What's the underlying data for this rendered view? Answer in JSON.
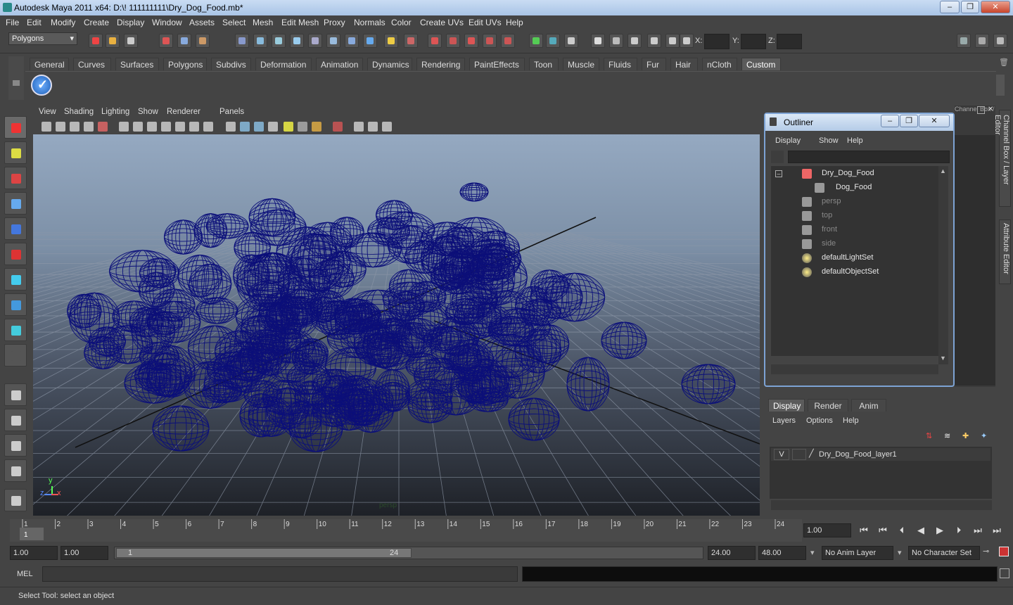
{
  "window": {
    "title": "Autodesk Maya 2011 x64: D:\\! 111111111\\Dry_Dog_Food.mb*",
    "min": "–",
    "max": "❐",
    "close": "✕"
  },
  "menus": [
    "File",
    "Edit",
    "Modify",
    "Create",
    "Display",
    "Window",
    "Assets",
    "Select",
    "Mesh",
    "Edit Mesh",
    "Proxy",
    "Normals",
    "Color",
    "Create UVs",
    "Edit UVs",
    "Help"
  ],
  "status": {
    "mode": "Polygons",
    "x_label": "X:",
    "y_label": "Y:",
    "z_label": "Z:"
  },
  "shelf_tabs": [
    "General",
    "Curves",
    "Surfaces",
    "Polygons",
    "Subdivs",
    "Deformation",
    "Animation",
    "Dynamics",
    "Rendering",
    "PaintEffects",
    "Toon",
    "Muscle",
    "Fluids",
    "Fur",
    "Hair",
    "nCloth",
    "Custom"
  ],
  "shelf_active": "Custom",
  "viewport": {
    "menus": [
      "View",
      "Shading",
      "Lighting",
      "Show",
      "Renderer",
      "Panels"
    ],
    "camera_label": "persp",
    "axis": {
      "x": "x",
      "y": "y",
      "z": "z"
    }
  },
  "outliner": {
    "title": "Outliner",
    "menus": [
      "Display",
      "Show",
      "Help"
    ],
    "items": [
      {
        "label": "Dry_Dog_Food",
        "dim": false,
        "icon": "transform-icon",
        "indent": 0
      },
      {
        "label": "Dog_Food",
        "dim": false,
        "icon": "mesh-icon",
        "indent": 1
      },
      {
        "label": "persp",
        "dim": true,
        "icon": "camera-icon",
        "indent": 0
      },
      {
        "label": "top",
        "dim": true,
        "icon": "camera-icon",
        "indent": 0
      },
      {
        "label": "front",
        "dim": true,
        "icon": "camera-icon",
        "indent": 0
      },
      {
        "label": "side",
        "dim": true,
        "icon": "camera-icon",
        "indent": 0
      },
      {
        "label": "defaultLightSet",
        "dim": false,
        "icon": "set-icon",
        "indent": 0
      },
      {
        "label": "defaultObjectSet",
        "dim": false,
        "icon": "set-icon",
        "indent": 0
      }
    ]
  },
  "channel_box_label": "Channel Box / Layer Editor",
  "side_tabs": [
    "Channel Box / Layer Editor",
    "Attribute Editor"
  ],
  "layer_editor": {
    "tabs": [
      "Display",
      "Render",
      "Anim"
    ],
    "menus": [
      "Layers",
      "Options",
      "Help"
    ],
    "layer": {
      "visibility": "V",
      "name": "Dry_Dog_Food_layer1"
    }
  },
  "timeline": {
    "ticks": [
      "1",
      "2",
      "3",
      "4",
      "5",
      "6",
      "7",
      "8",
      "9",
      "10",
      "11",
      "12",
      "13",
      "14",
      "15",
      "16",
      "17",
      "18",
      "19",
      "20",
      "21",
      "22",
      "23",
      "24"
    ],
    "current": "1",
    "current_field": "1.00"
  },
  "range": {
    "start": "1.00",
    "start2": "1.00",
    "slider_start": "1",
    "slider_end": "24",
    "end": "24.00",
    "end2": "48.00",
    "anim_layer": "No Anim Layer",
    "char_set": "No Character Set"
  },
  "cmd": {
    "label": "MEL"
  },
  "help": {
    "text": "Select Tool: select an object"
  }
}
